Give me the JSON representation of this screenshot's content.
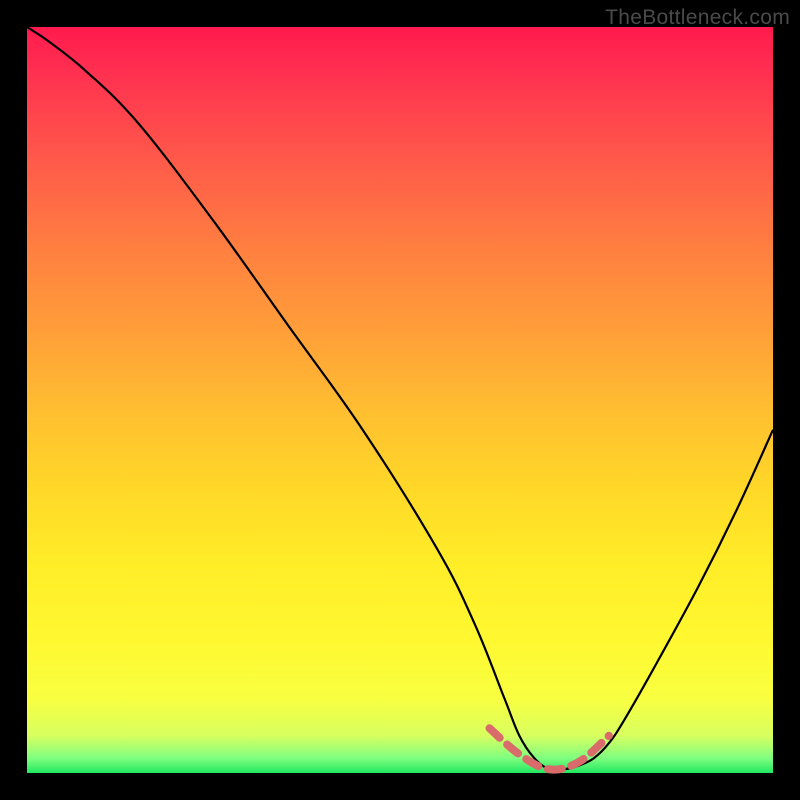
{
  "watermark": "TheBottleneck.com",
  "chart_data": {
    "type": "line",
    "title": "",
    "xlabel": "",
    "ylabel": "",
    "xlim": [
      0,
      100
    ],
    "ylim": [
      0,
      100
    ],
    "grid": false,
    "legend": false,
    "description": "Bottleneck severity curve on red-to-green gradient; y=100 is worst (red), y=0 is best (green). Curve starts near top-left, descends steeply to a flat optimum near x≈70, then rises to the right.",
    "series": [
      {
        "name": "bottleneck-curve",
        "color": "#000000",
        "x": [
          0,
          3,
          8,
          15,
          25,
          35,
          45,
          55,
          60,
          64,
          66,
          68,
          70,
          72,
          74,
          76,
          78,
          80,
          84,
          90,
          95,
          100
        ],
        "values": [
          100,
          98,
          94,
          87,
          74,
          60,
          46,
          30,
          20,
          10,
          5,
          2,
          0.5,
          0.5,
          1,
          2,
          4,
          7,
          14,
          25,
          35,
          46
        ]
      },
      {
        "name": "optimum-dash",
        "color": "#d96b6b",
        "x": [
          62,
          66,
          70,
          74,
          78
        ],
        "values": [
          6,
          2.5,
          0.5,
          1.5,
          5
        ]
      }
    ]
  }
}
